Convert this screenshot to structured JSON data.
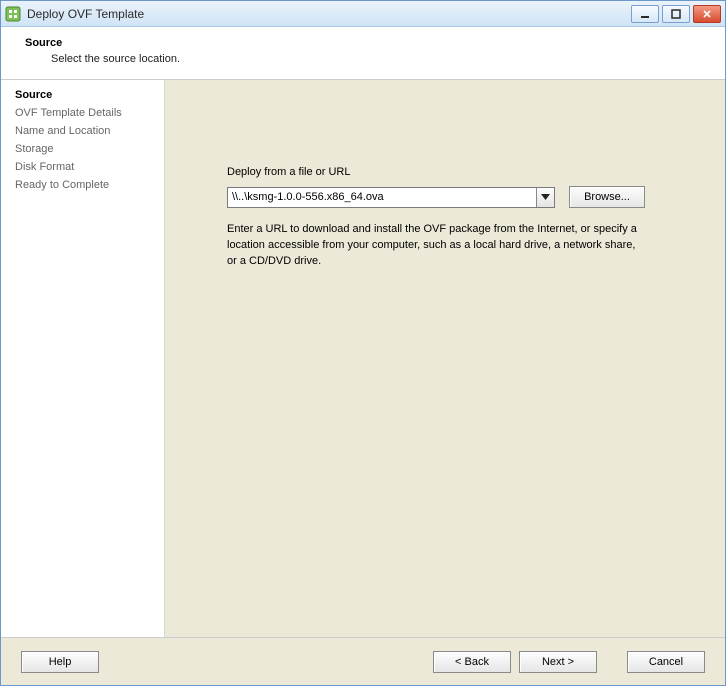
{
  "window": {
    "title": "Deploy OVF Template"
  },
  "header": {
    "title": "Source",
    "subtitle": "Select the source location."
  },
  "sidebar": {
    "steps": [
      {
        "label": "Source",
        "active": true
      },
      {
        "label": "OVF Template Details",
        "active": false
      },
      {
        "label": "Name and Location",
        "active": false
      },
      {
        "label": "Storage",
        "active": false
      },
      {
        "label": "Disk Format",
        "active": false
      },
      {
        "label": "Ready to Complete",
        "active": false
      }
    ]
  },
  "content": {
    "field_label": "Deploy from a file or URL",
    "path_value": "\\\\..\\ksmg-1.0.0-556.x86_64.ova",
    "browse_label": "Browse...",
    "hint": "Enter a URL to download and install the OVF package from the Internet, or specify a location accessible from your computer, such as a local hard drive, a network share, or a CD/DVD drive."
  },
  "footer": {
    "help": "Help",
    "back": "< Back",
    "next": "Next >",
    "cancel": "Cancel"
  }
}
